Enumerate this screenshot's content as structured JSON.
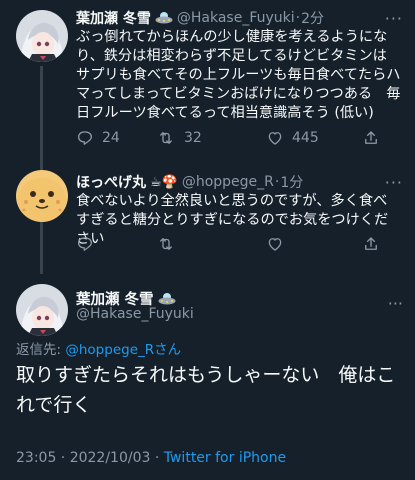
{
  "tweet1": {
    "name": "葉加瀬 冬雪",
    "badge_emoji": "🛸",
    "handle": "@Hakase_Fuyuki",
    "sep": "·",
    "time": "2分",
    "more": "···",
    "text": "ぶっ倒れてからほんの少し健康を考えるようになり、鉄分は相変わらず不足してるけどビタミンはサプリも食べてその上フルーツも毎日食べてたらハマってしまってビタミンおばけになりつつある　毎日フルーツ食べてるって相当意識高そう (低い)",
    "replies": "24",
    "retweets": "32",
    "likes": "445"
  },
  "tweet2": {
    "name": "ほっぺげ丸",
    "name_emojis": "☕🍄",
    "handle": "@hoppege_R",
    "sep": "·",
    "time": "1分",
    "more": "···",
    "text": "食べないより全然良いと思うのですが、多く食べすぎると糖分とりすぎになるのでお気をつけください"
  },
  "main": {
    "name": "葉加瀬 冬雪",
    "badge_emoji": "🛸",
    "handle": "@Hakase_Fuyuki",
    "more": "···",
    "reply_prefix": "返信先:",
    "reply_handle": "@hoppege_R",
    "reply_suffix": "さん",
    "text": "取りすぎたらそれはもうしゃーない　俺はこれで行く",
    "timestamp": "23:05 · 2022/10/03 · ",
    "source": "Twitter for iPhone"
  },
  "colors": {
    "background": "#15202b",
    "text": "#f7f9f9",
    "muted": "#8b98a5",
    "link": "#1d9bf0",
    "thread_line": "#38444d"
  }
}
